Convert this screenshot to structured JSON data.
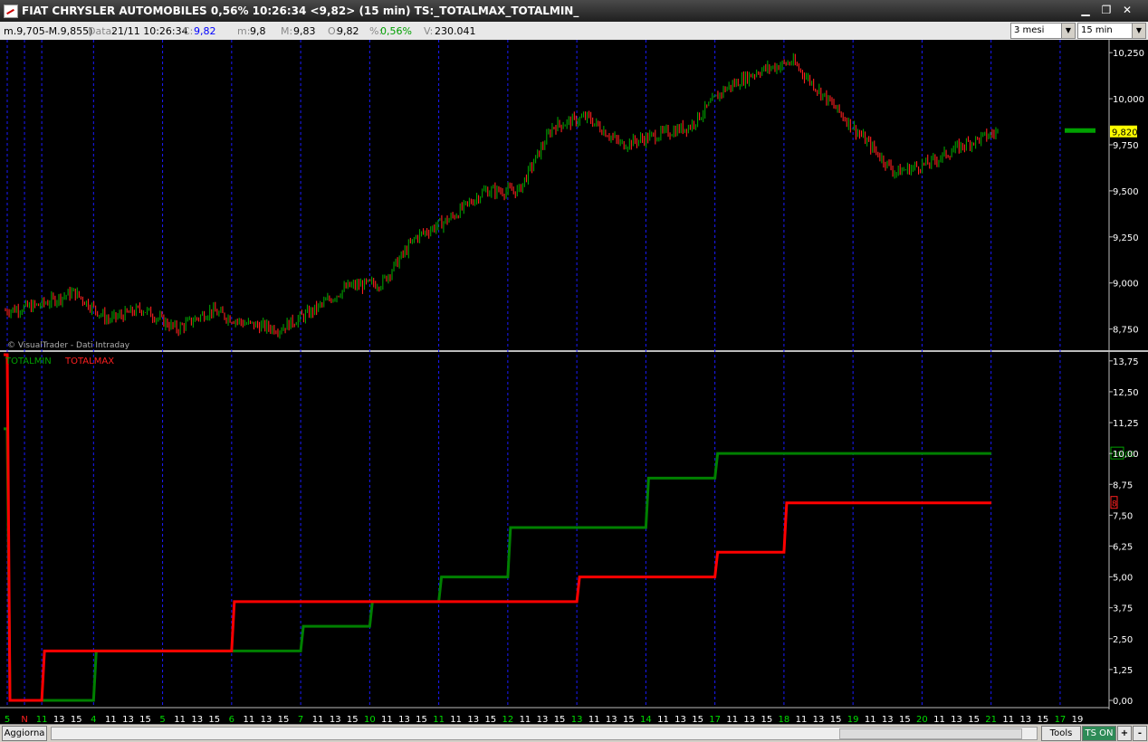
{
  "window": {
    "title": "FIAT CHRYSLER AUTOMOBILES 0,56% 10:26:34  <9,82> (15 min) TS:_TOTALMAX_TOTALMIN_"
  },
  "infobar": {
    "range": "m.9,705-M.9,855)",
    "data_label": "Data:",
    "data_value": "21/11 10:26:34",
    "c_label": "C:",
    "c_value": "9,82",
    "m_label": "m:",
    "m_value": "9,8",
    "M_label": "M:",
    "M_value": "9,83",
    "o_label": "O:",
    "o_value": "9,82",
    "pct_label": "%:",
    "pct_value": "0,56%",
    "v_label": "V:",
    "v_value": "230.041",
    "period_select": "3 mesi",
    "interval_select": "15 min"
  },
  "price_panel": {
    "watermark": "© VisualTrader - Dati Intraday",
    "y_ticks": [
      "10,250",
      "10,000",
      "9,750",
      "9,500",
      "9,250",
      "9,000",
      "8,750"
    ],
    "y_values": [
      10.25,
      10.0,
      9.75,
      9.5,
      9.25,
      9.0,
      8.75
    ],
    "last_price_label": "9,820",
    "last_price": 9.82
  },
  "indicator_panel": {
    "legend": [
      "TOTALMIN",
      "TOTALMAX"
    ],
    "y_ticks": [
      "13,75",
      "12,50",
      "11,25",
      "10,00",
      "8,75",
      "7,50",
      "6,25",
      "5,00",
      "3,75",
      "2,50",
      "1,25",
      "0,00"
    ],
    "y_values": [
      13.75,
      12.5,
      11.25,
      10.0,
      8.75,
      7.5,
      6.25,
      5.0,
      3.75,
      2.5,
      1.25,
      0.0
    ],
    "totalmin_last_label": "10,00",
    "totalmax_last_label": "8"
  },
  "chart_data": [
    {
      "type": "candlestick",
      "title": "FIAT CHRYSLER AUTOMOBILES (15 min)",
      "x": [
        "5",
        "N",
        "4",
        "5",
        "6",
        "7",
        "10",
        "11",
        "12",
        "13",
        "14",
        "17",
        "18",
        "19",
        "20",
        "21"
      ],
      "ylim": [
        8.65,
        10.3
      ],
      "series": [
        {
          "values": [
            8.85,
            8.88,
            8.95,
            8.8,
            8.86,
            8.75,
            8.85,
            8.78,
            8.75,
            8.85,
            8.98,
            9.0,
            9.25,
            9.35,
            9.5,
            9.5,
            9.85,
            9.9,
            9.75,
            9.8,
            9.85,
            10.05,
            10.15,
            10.2,
            10.0,
            9.8,
            9.6,
            9.65,
            9.75,
            9.82
          ]
        }
      ],
      "grid": true,
      "legend": "none"
    },
    {
      "type": "line",
      "x": [
        "5",
        "N",
        "4",
        "5",
        "6",
        "7",
        "10",
        "11",
        "12",
        "13",
        "14",
        "17",
        "18",
        "19",
        "20",
        "21"
      ],
      "ylim": [
        0,
        14
      ],
      "series": [
        {
          "name": "TOTALMIN",
          "color": "#008000",
          "values": [
            11,
            0,
            0,
            0,
            2,
            2,
            2,
            3,
            4,
            5,
            7,
            7,
            9,
            10,
            10,
            10
          ]
        },
        {
          "name": "TOTALMAX",
          "color": "#ff0000",
          "values": [
            14,
            0,
            0,
            2,
            2,
            2,
            4,
            4,
            4,
            4,
            4,
            5,
            5,
            6,
            8,
            8
          ]
        }
      ],
      "grid": true,
      "legend": "top-left"
    }
  ],
  "xaxis": {
    "labels": [
      "5",
      "N",
      "11",
      "13",
      "15",
      "4",
      "11",
      "13",
      "15",
      "5",
      "11",
      "13",
      "15",
      "6",
      "11",
      "13",
      "15",
      "7",
      "11",
      "13",
      "15",
      "10",
      "11",
      "13",
      "15",
      "11",
      "11",
      "13",
      "15",
      "12",
      "11",
      "13",
      "15",
      "13",
      "11",
      "13",
      "15",
      "14",
      "11",
      "13",
      "15",
      "17",
      "11",
      "13",
      "15",
      "18",
      "11",
      "13",
      "15",
      "19",
      "11",
      "13",
      "15",
      "20",
      "11",
      "13",
      "15",
      "21",
      "11",
      "13",
      "15",
      "17",
      "19"
    ],
    "highlight": [
      "N"
    ],
    "day_labels": [
      "4",
      "5",
      "6",
      "7",
      "10",
      "11",
      "12",
      "13",
      "14",
      "17",
      "18",
      "19",
      "20",
      "21"
    ]
  },
  "bottom": {
    "refresh_label": "Aggiorna",
    "tools_label": "Tools",
    "ts_label": "TS ON",
    "plus_label": "+",
    "minus_label": "-"
  },
  "colors": {
    "background": "#000000",
    "up": "#00a000",
    "down": "#ff2020",
    "grid": "#1a1aff",
    "last_price_bg": "#ffff00"
  }
}
